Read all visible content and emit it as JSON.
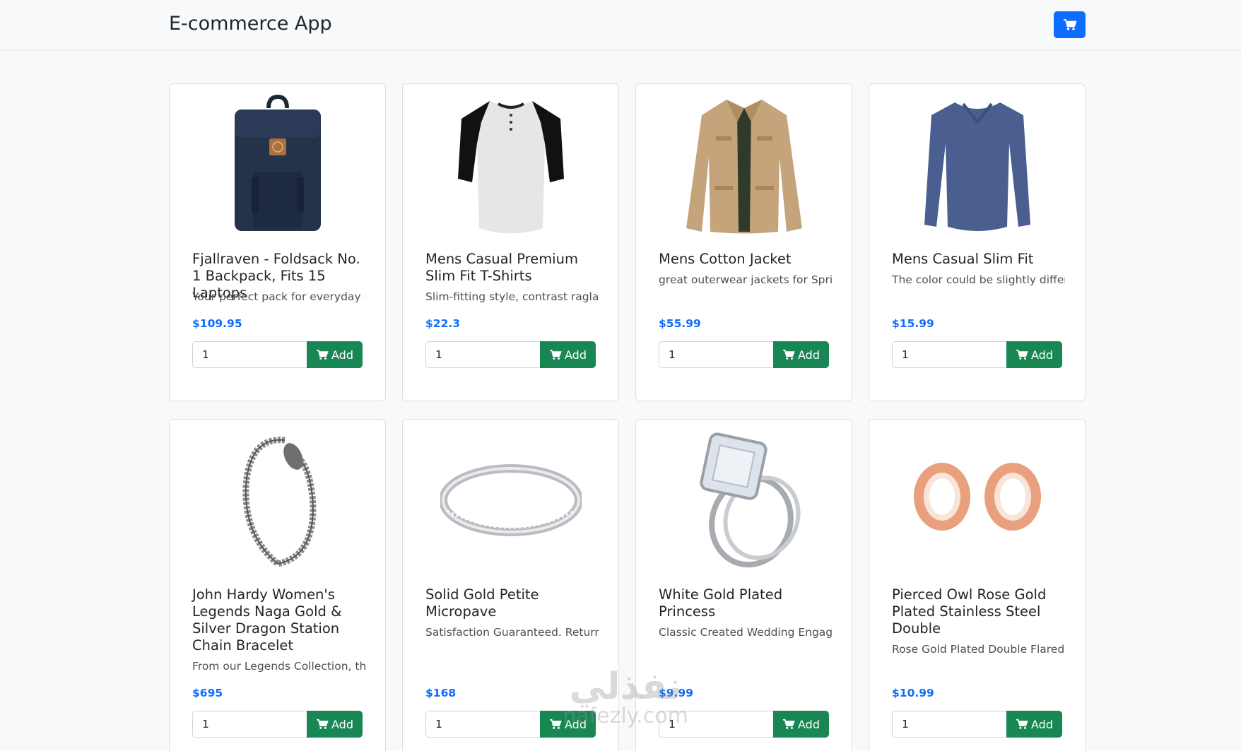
{
  "app": {
    "title": "E-commerce App",
    "cart_icon": "cart-icon",
    "accent": "#0d6efd",
    "add_color": "#198754"
  },
  "products": [
    {
      "title": "Fjallraven - Foldsack No. 1 Backpack, Fits 15 Laptops",
      "description": "Your perfect pack for everyday u...",
      "price": "$109.95",
      "quantity": "1",
      "add_label": "Add",
      "image": "backpack-image"
    },
    {
      "title": "Mens Casual Premium Slim Fit T-Shirts",
      "description": "Slim-fitting style, contrast ragla...",
      "price": "$22.3",
      "quantity": "1",
      "add_label": "Add",
      "image": "tshirt-image"
    },
    {
      "title": "Mens Cotton Jacket",
      "description": "great outerwear jackets for Spri...",
      "price": "$55.99",
      "quantity": "1",
      "add_label": "Add",
      "image": "jacket-image"
    },
    {
      "title": "Mens Casual Slim Fit",
      "description": "The color could be slightly differ...",
      "price": "$15.99",
      "quantity": "1",
      "add_label": "Add",
      "image": "longsleeve-image"
    },
    {
      "title": "John Hardy Women's Legends Naga Gold & Silver Dragon Station Chain Bracelet",
      "description": "From our Legends Collection, th...",
      "price": "$695",
      "quantity": "1",
      "add_label": "Add",
      "image": "bracelet-image"
    },
    {
      "title": "Solid Gold Petite Micropave",
      "description": "Satisfaction Guaranteed. Return ...",
      "price": "$168",
      "quantity": "1",
      "add_label": "Add",
      "image": "ring-image"
    },
    {
      "title": "White Gold Plated Princess",
      "description": "Classic Created Wedding Engag...",
      "price": "$9.99",
      "quantity": "1",
      "add_label": "Add",
      "image": "princess-ring-image"
    },
    {
      "title": "Pierced Owl Rose Gold Plated Stainless Steel Double",
      "description": "Rose Gold Plated Double Flared ...",
      "price": "$10.99",
      "quantity": "1",
      "add_label": "Add",
      "image": "earrings-image"
    }
  ],
  "watermark": {
    "line1": "نفذلي",
    "line2": "nafezly.com"
  }
}
